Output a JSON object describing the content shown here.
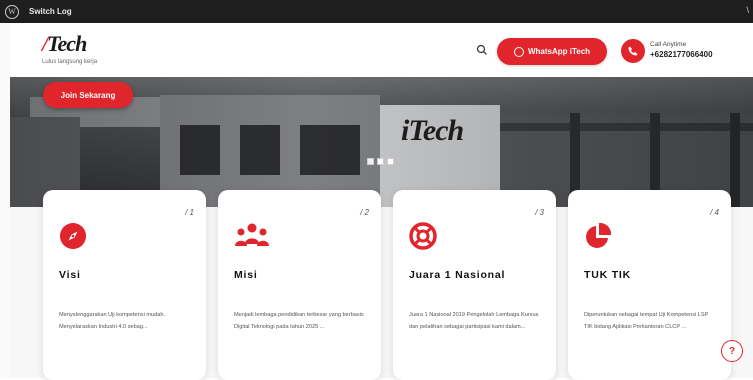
{
  "admin_bar": {
    "label": "Switch Log",
    "right_mark": "\\"
  },
  "header": {
    "logo_text": "Tech",
    "tagline": "Lulus langsung kerja",
    "whatsapp_label": "WhatsApp iTech",
    "call_label": "Call Anytime",
    "call_number": "+6282177066400"
  },
  "hero": {
    "join_label": "Join Sekarang",
    "sign_text": "iTech",
    "slides": 3
  },
  "colors": {
    "accent": "#e0252c",
    "admin_bar": "#1e1e1e"
  },
  "cards": [
    {
      "num": "/ 1",
      "title": "Visi",
      "icon": "compass-icon",
      "desc": "Menyelenggarakan Uji kompetensi mudah. Menyelaraskan Industri 4.0 sebag..."
    },
    {
      "num": "/ 2",
      "title": "Misi",
      "icon": "people-icon",
      "desc": "Menjadi lembaga pendidikan terbesar yang berbasis Digital Teknologi pada tahun 2025 ..."
    },
    {
      "num": "/ 3",
      "title": "Juara 1 Nasional",
      "icon": "lifebuoy-icon",
      "desc": "Juara 1 Nasional 2019 Pengelolah Lembaga Kursus dan pelatihan sebagai partisipasi kami dalam..."
    },
    {
      "num": "/ 4",
      "title": "TUK TIK",
      "icon": "pie-chart-icon",
      "desc": "Diperuntukan sebagai tempat Uji Kompetensi LSP TIK bidang Aplikasi Perkantoran CLCP ..."
    }
  ],
  "help_label": "?"
}
